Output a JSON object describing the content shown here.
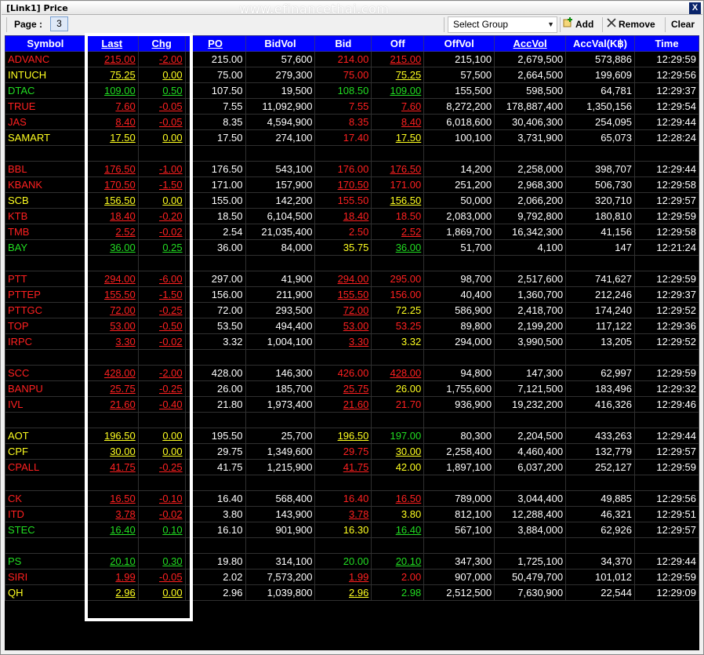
{
  "window": {
    "title": "[Link1] Price",
    "watermark": "www.efinancethai.com",
    "close_label": "X"
  },
  "toolbar": {
    "page_label": "Page :",
    "page_value": "3",
    "group_select": "Select Group",
    "add_label": "Add",
    "remove_label": "Remove",
    "clear_label": "Clear"
  },
  "columns": [
    "Symbol",
    "Last",
    "Chg",
    "PO",
    "BidVol",
    "Bid",
    "Off",
    "OffVol",
    "AccVol",
    "AccVal(K฿)",
    "Time"
  ],
  "colors": {
    "red": "#ff2020",
    "yellow": "#ffff20",
    "green": "#22dd22",
    "white": "#ffffff",
    "header_bg": "#0000ff"
  },
  "rows": [
    {
      "symbol": "ADVANC",
      "c": "r",
      "last": "215.00",
      "chg": "-2.00",
      "po": "215.00",
      "bidvol": "57,600",
      "bid": "214.00",
      "bc": "r",
      "off": "215.00",
      "oc": "r",
      "offvol": "215,100",
      "accvol": "2,679,500",
      "accval": "573,886",
      "time": "12:29:59"
    },
    {
      "symbol": "INTUCH",
      "c": "y",
      "last": "75.25",
      "chg": "0.00",
      "po": "75.00",
      "bidvol": "279,300",
      "bid": "75.00",
      "bc": "r",
      "off": "75.25",
      "oc": "y",
      "offvol": "57,500",
      "accvol": "2,664,500",
      "accval": "199,609",
      "time": "12:29:56"
    },
    {
      "symbol": "DTAC",
      "c": "g",
      "last": "109.00",
      "chg": "0.50",
      "po": "107.50",
      "bidvol": "19,500",
      "bid": "108.50",
      "bc": "g",
      "off": "109.00",
      "oc": "g",
      "offvol": "155,500",
      "accvol": "598,500",
      "accval": "64,781",
      "time": "12:29:37"
    },
    {
      "symbol": "TRUE",
      "c": "r",
      "last": "7.60",
      "chg": "-0.05",
      "po": "7.55",
      "bidvol": "11,092,900",
      "bid": "7.55",
      "bc": "r",
      "off": "7.60",
      "oc": "r",
      "offvol": "8,272,200",
      "accvol": "178,887,400",
      "accval": "1,350,156",
      "time": "12:29:54"
    },
    {
      "symbol": "JAS",
      "c": "r",
      "last": "8.40",
      "chg": "-0.05",
      "po": "8.35",
      "bidvol": "4,594,900",
      "bid": "8.35",
      "bc": "r",
      "off": "8.40",
      "oc": "r",
      "offvol": "6,018,600",
      "accvol": "30,406,300",
      "accval": "254,095",
      "time": "12:29:44"
    },
    {
      "symbol": "SAMART",
      "c": "y",
      "last": "17.50",
      "chg": "0.00",
      "po": "17.50",
      "bidvol": "274,100",
      "bid": "17.40",
      "bc": "r",
      "off": "17.50",
      "oc": "y",
      "offvol": "100,100",
      "accvol": "3,731,900",
      "accval": "65,073",
      "time": "12:28:24"
    },
    {
      "blank": true
    },
    {
      "symbol": "BBL",
      "c": "r",
      "last": "176.50",
      "chg": "-1.00",
      "po": "176.50",
      "bidvol": "543,100",
      "bid": "176.00",
      "bc": "r",
      "off": "176.50",
      "oc": "r",
      "offvol": "14,200",
      "accvol": "2,258,000",
      "accval": "398,707",
      "time": "12:29:44"
    },
    {
      "symbol": "KBANK",
      "c": "r",
      "last": "170.50",
      "chg": "-1.50",
      "po": "171.00",
      "bidvol": "157,900",
      "bid": "170.50",
      "bc": "r",
      "off": "171.00",
      "oc": "r",
      "offvol": "251,200",
      "accvol": "2,968,300",
      "accval": "506,730",
      "time": "12:29:58"
    },
    {
      "symbol": "SCB",
      "c": "y",
      "last": "156.50",
      "chg": "0.00",
      "po": "155.00",
      "bidvol": "142,200",
      "bid": "155.50",
      "bc": "r",
      "off": "156.50",
      "oc": "y",
      "offvol": "50,000",
      "accvol": "2,066,200",
      "accval": "320,710",
      "time": "12:29:57"
    },
    {
      "symbol": "KTB",
      "c": "r",
      "last": "18.40",
      "chg": "-0.20",
      "po": "18.50",
      "bidvol": "6,104,500",
      "bid": "18.40",
      "bc": "r",
      "off": "18.50",
      "oc": "r",
      "offvol": "2,083,000",
      "accvol": "9,792,800",
      "accval": "180,810",
      "time": "12:29:59"
    },
    {
      "symbol": "TMB",
      "c": "r",
      "last": "2.52",
      "chg": "-0.02",
      "po": "2.54",
      "bidvol": "21,035,400",
      "bid": "2.50",
      "bc": "r",
      "off": "2.52",
      "oc": "r",
      "offvol": "1,869,700",
      "accvol": "16,342,300",
      "accval": "41,156",
      "time": "12:29:58"
    },
    {
      "symbol": "BAY",
      "c": "g",
      "last": "36.00",
      "chg": "0.25",
      "po": "36.00",
      "bidvol": "84,000",
      "bid": "35.75",
      "bc": "y",
      "off": "36.00",
      "oc": "g",
      "offvol": "51,700",
      "accvol": "4,100",
      "accval": "147",
      "time": "12:21:24"
    },
    {
      "blank": true
    },
    {
      "symbol": "PTT",
      "c": "r",
      "last": "294.00",
      "chg": "-6.00",
      "po": "297.00",
      "bidvol": "41,900",
      "bid": "294.00",
      "bc": "r",
      "off": "295.00",
      "oc": "r",
      "offvol": "98,700",
      "accvol": "2,517,600",
      "accval": "741,627",
      "time": "12:29:59"
    },
    {
      "symbol": "PTTEP",
      "c": "r",
      "last": "155.50",
      "chg": "-1.50",
      "po": "156.00",
      "bidvol": "211,900",
      "bid": "155.50",
      "bc": "r",
      "off": "156.00",
      "oc": "r",
      "offvol": "40,400",
      "accvol": "1,360,700",
      "accval": "212,246",
      "time": "12:29:37"
    },
    {
      "symbol": "PTTGC",
      "c": "r",
      "last": "72.00",
      "chg": "-0.25",
      "po": "72.00",
      "bidvol": "293,500",
      "bid": "72.00",
      "bc": "r",
      "off": "72.25",
      "oc": "y",
      "offvol": "586,900",
      "accvol": "2,418,700",
      "accval": "174,240",
      "time": "12:29:52"
    },
    {
      "symbol": "TOP",
      "c": "r",
      "last": "53.00",
      "chg": "-0.50",
      "po": "53.50",
      "bidvol": "494,400",
      "bid": "53.00",
      "bc": "r",
      "off": "53.25",
      "oc": "r",
      "offvol": "89,800",
      "accvol": "2,199,200",
      "accval": "117,122",
      "time": "12:29:36"
    },
    {
      "symbol": "IRPC",
      "c": "r",
      "last": "3.30",
      "chg": "-0.02",
      "po": "3.32",
      "bidvol": "1,004,100",
      "bid": "3.30",
      "bc": "r",
      "off": "3.32",
      "oc": "y",
      "offvol": "294,000",
      "accvol": "3,990,500",
      "accval": "13,205",
      "time": "12:29:52"
    },
    {
      "blank": true
    },
    {
      "symbol": "SCC",
      "c": "r",
      "last": "428.00",
      "chg": "-2.00",
      "po": "428.00",
      "bidvol": "146,300",
      "bid": "426.00",
      "bc": "r",
      "off": "428.00",
      "oc": "r",
      "offvol": "94,800",
      "accvol": "147,300",
      "accval": "62,997",
      "time": "12:29:59"
    },
    {
      "symbol": "BANPU",
      "c": "r",
      "last": "25.75",
      "chg": "-0.25",
      "po": "26.00",
      "bidvol": "185,700",
      "bid": "25.75",
      "bc": "r",
      "off": "26.00",
      "oc": "y",
      "offvol": "1,755,600",
      "accvol": "7,121,500",
      "accval": "183,496",
      "time": "12:29:32"
    },
    {
      "symbol": "IVL",
      "c": "r",
      "last": "21.60",
      "chg": "-0.40",
      "po": "21.80",
      "bidvol": "1,973,400",
      "bid": "21.60",
      "bc": "r",
      "off": "21.70",
      "oc": "r",
      "offvol": "936,900",
      "accvol": "19,232,200",
      "accval": "416,326",
      "time": "12:29:46"
    },
    {
      "blank": true
    },
    {
      "symbol": "AOT",
      "c": "y",
      "last": "196.50",
      "chg": "0.00",
      "po": "195.50",
      "bidvol": "25,700",
      "bid": "196.50",
      "bc": "y",
      "off": "197.00",
      "oc": "g",
      "offvol": "80,300",
      "accvol": "2,204,500",
      "accval": "433,263",
      "time": "12:29:44"
    },
    {
      "symbol": "CPF",
      "c": "y",
      "last": "30.00",
      "chg": "0.00",
      "po": "29.75",
      "bidvol": "1,349,600",
      "bid": "29.75",
      "bc": "r",
      "off": "30.00",
      "oc": "y",
      "offvol": "2,258,400",
      "accvol": "4,460,400",
      "accval": "132,779",
      "time": "12:29:57"
    },
    {
      "symbol": "CPALL",
      "c": "r",
      "last": "41.75",
      "chg": "-0.25",
      "po": "41.75",
      "bidvol": "1,215,900",
      "bid": "41.75",
      "bc": "r",
      "off": "42.00",
      "oc": "y",
      "offvol": "1,897,100",
      "accvol": "6,037,200",
      "accval": "252,127",
      "time": "12:29:59"
    },
    {
      "blank": true
    },
    {
      "symbol": "CK",
      "c": "r",
      "last": "16.50",
      "chg": "-0.10",
      "po": "16.40",
      "bidvol": "568,400",
      "bid": "16.40",
      "bc": "r",
      "off": "16.50",
      "oc": "r",
      "offvol": "789,000",
      "accvol": "3,044,400",
      "accval": "49,885",
      "time": "12:29:56"
    },
    {
      "symbol": "ITD",
      "c": "r",
      "last": "3.78",
      "chg": "-0.02",
      "po": "3.80",
      "bidvol": "143,900",
      "bid": "3.78",
      "bc": "r",
      "off": "3.80",
      "oc": "y",
      "offvol": "812,100",
      "accvol": "12,288,400",
      "accval": "46,321",
      "time": "12:29:51"
    },
    {
      "symbol": "STEC",
      "c": "g",
      "last": "16.40",
      "chg": "0.10",
      "po": "16.10",
      "bidvol": "901,900",
      "bid": "16.30",
      "bc": "y",
      "off": "16.40",
      "oc": "g",
      "offvol": "567,100",
      "accvol": "3,884,000",
      "accval": "62,926",
      "time": "12:29:57"
    },
    {
      "blank": true
    },
    {
      "symbol": "PS",
      "c": "g",
      "last": "20.10",
      "chg": "0.30",
      "po": "19.80",
      "bidvol": "314,100",
      "bid": "20.00",
      "bc": "g",
      "off": "20.10",
      "oc": "g",
      "offvol": "347,300",
      "accvol": "1,725,100",
      "accval": "34,370",
      "time": "12:29:44"
    },
    {
      "symbol": "SIRI",
      "c": "r",
      "last": "1.99",
      "chg": "-0.05",
      "po": "2.02",
      "bidvol": "7,573,200",
      "bid": "1.99",
      "bc": "r",
      "off": "2.00",
      "oc": "r",
      "offvol": "907,000",
      "accvol": "50,479,700",
      "accval": "101,012",
      "time": "12:29:59"
    },
    {
      "symbol": "QH",
      "c": "y",
      "last": "2.96",
      "chg": "0.00",
      "po": "2.96",
      "bidvol": "1,039,800",
      "bid": "2.96",
      "bc": "y",
      "off": "2.98",
      "oc": "g",
      "offvol": "2,512,500",
      "accvol": "7,630,900",
      "accval": "22,544",
      "time": "12:29:09"
    }
  ]
}
